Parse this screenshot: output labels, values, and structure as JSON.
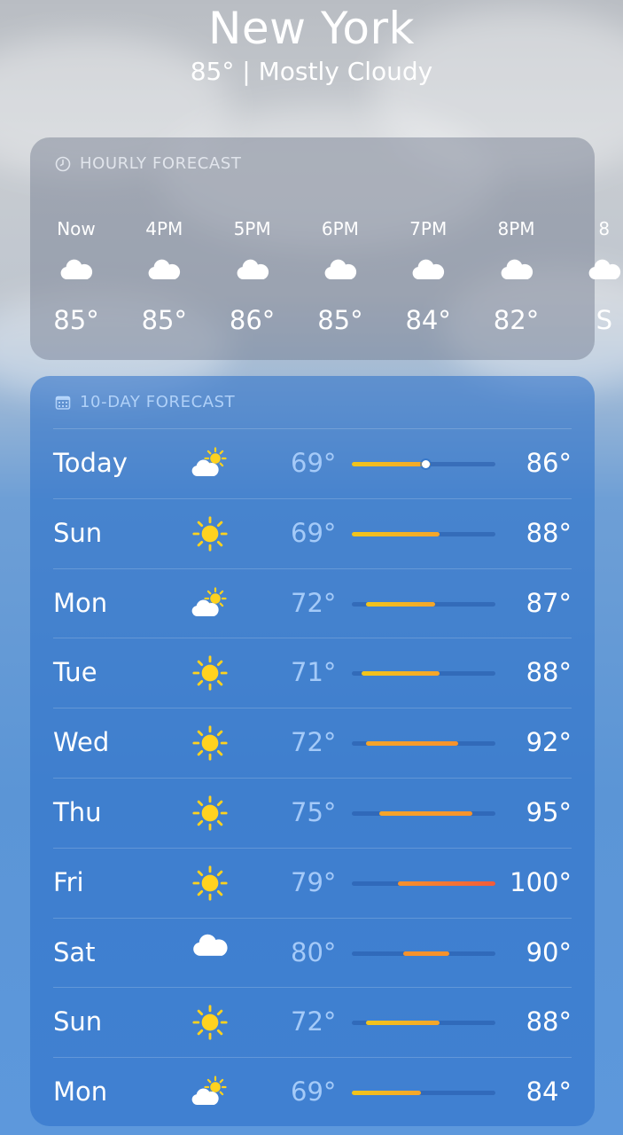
{
  "header": {
    "city": "New York",
    "summary": "85°  |  Mostly Cloudy"
  },
  "hourly": {
    "title": "HOURLY FORECAST",
    "items": [
      {
        "time": "Now",
        "icon": "cloud-icon",
        "temp": "85°"
      },
      {
        "time": "4PM",
        "icon": "cloud-icon",
        "temp": "85°"
      },
      {
        "time": "5PM",
        "icon": "cloud-icon",
        "temp": "86°"
      },
      {
        "time": "6PM",
        "icon": "cloud-icon",
        "temp": "85°"
      },
      {
        "time": "7PM",
        "icon": "cloud-icon",
        "temp": "84°"
      },
      {
        "time": "8PM",
        "icon": "cloud-icon",
        "temp": "82°"
      },
      {
        "time": "8",
        "icon": "cloud-icon",
        "temp": "S"
      }
    ]
  },
  "daily": {
    "title": "10-DAY FORECAST",
    "scale": {
      "min": 69,
      "max": 100
    },
    "current_temp": 85,
    "days": [
      {
        "day": "Today",
        "icon": "partly-cloudy-icon",
        "low": "69°",
        "high": "86°",
        "lo": 69,
        "hi": 86
      },
      {
        "day": "Sun",
        "icon": "sun-icon",
        "low": "69°",
        "high": "88°",
        "lo": 69,
        "hi": 88
      },
      {
        "day": "Mon",
        "icon": "partly-cloudy-icon",
        "low": "72°",
        "high": "87°",
        "lo": 72,
        "hi": 87
      },
      {
        "day": "Tue",
        "icon": "sun-icon",
        "low": "71°",
        "high": "88°",
        "lo": 71,
        "hi": 88
      },
      {
        "day": "Wed",
        "icon": "sun-icon",
        "low": "72°",
        "high": "92°",
        "lo": 72,
        "hi": 92
      },
      {
        "day": "Thu",
        "icon": "sun-icon",
        "low": "75°",
        "high": "95°",
        "lo": 75,
        "hi": 95
      },
      {
        "day": "Fri",
        "icon": "sun-icon",
        "low": "79°",
        "high": "100°",
        "lo": 79,
        "hi": 100
      },
      {
        "day": "Sat",
        "icon": "cloud-icon",
        "low": "80°",
        "high": "90°",
        "lo": 80,
        "hi": 90
      },
      {
        "day": "Sun",
        "icon": "sun-icon",
        "low": "72°",
        "high": "88°",
        "lo": 72,
        "hi": 88
      },
      {
        "day": "Mon",
        "icon": "partly-cloudy-icon",
        "low": "69°",
        "high": "84°",
        "lo": 69,
        "hi": 84
      }
    ]
  },
  "colors": {
    "sun": "#ffd21f",
    "cool": "#f2c51b",
    "warm": "#f6922c",
    "hot": "#f25b3a"
  }
}
